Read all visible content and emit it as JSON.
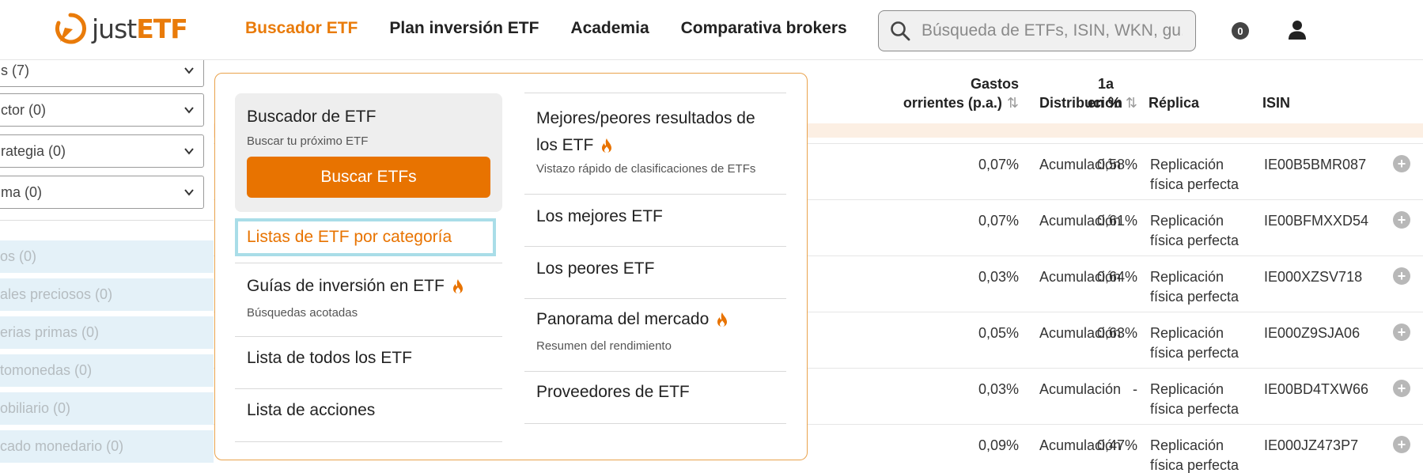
{
  "header": {
    "logo_just": "just",
    "logo_etf": "ETF",
    "nav": [
      "Buscador ETF",
      "Plan inversión ETF",
      "Academia",
      "Comparativa brokers"
    ],
    "search_placeholder": "Búsqueda de ETFs, ISIN, WKN, gu...",
    "watchlist_count": "0"
  },
  "sidebar": {
    "selects": [
      "s (7)",
      "ctor (0)",
      "rategia (0)",
      "ma (0)"
    ],
    "categories": [
      "os (0)",
      "ales preciosos (0)",
      "erias primas (0)",
      "tomonedas (0)",
      "obiliario (0)",
      "cado monedario (0)"
    ]
  },
  "table": {
    "headers": {
      "gastos": "Gastos",
      "corrientes": "orrientes (p.a.)",
      "one_a": "1a",
      "en_pct": "en %",
      "distribucion": "Distribución",
      "replica": "Réplica",
      "isin": "ISIN"
    },
    "rows": [
      {
        "ter": "0,07%",
        "ret": "0,58%",
        "dist": "Acumulación",
        "rep1": "Replicación",
        "rep2": "física perfecta",
        "isin": "IE00B5BMR087"
      },
      {
        "ter": "0,07%",
        "ret": "0,61%",
        "dist": "Acumulación",
        "rep1": "Replicación",
        "rep2": "física perfecta",
        "isin": "IE00BFMXXD54"
      },
      {
        "ter": "0,03%",
        "ret": "0,64%",
        "dist": "Acumulación",
        "rep1": "Replicación",
        "rep2": "física perfecta",
        "isin": "IE000XZSV718"
      },
      {
        "ter": "0,05%",
        "ret": "0,63%",
        "dist": "Acumulación",
        "rep1": "Replicación",
        "rep2": "física perfecta",
        "isin": "IE000Z9SJA06"
      },
      {
        "ter": "0,03%",
        "ret": "-",
        "dist": "Acumulación",
        "rep1": "Replicación",
        "rep2": "física perfecta",
        "isin": "IE00BD4TXW66"
      },
      {
        "ter": "0,09%",
        "ret": "0,47%",
        "dist": "Acumulación",
        "rep1": "Replicación",
        "rep2": "física perfecta",
        "isin": "IE000JZ473P7"
      }
    ]
  },
  "dropdown": {
    "card": {
      "title": "Buscador de ETF",
      "subtitle": "Buscar tu próximo ETF",
      "button": "Buscar ETFs"
    },
    "focused_link": "Listas de ETF por categoría",
    "left_items": [
      {
        "title": "Guías de inversión en ETF",
        "subtitle": "Búsquedas acotadas"
      },
      {
        "title": "Lista de todos los ETF"
      },
      {
        "title": "Lista de acciones"
      }
    ],
    "right_items": [
      {
        "title_line1": "Mejores/peores resultados de",
        "title_line2": "los ETF",
        "subtitle": "Vistazo rápido de clasificaciones de ETFs"
      },
      {
        "title": "Los mejores ETF"
      },
      {
        "title": "Los peores ETF"
      },
      {
        "title": "Panorama del mercado",
        "subtitle": "Resumen del rendimiento"
      },
      {
        "title": "Proveedores de ETF"
      }
    ]
  },
  "colors": {
    "brand_orange": "#e87300",
    "focus_ring": "#a9dde8"
  }
}
